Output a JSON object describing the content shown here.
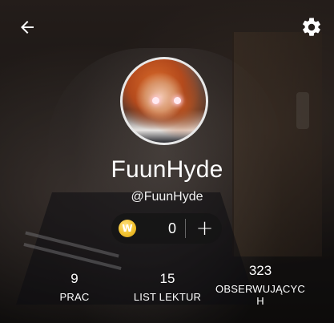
{
  "header": {
    "back_icon": "arrow-left-icon",
    "settings_icon": "gear-icon"
  },
  "profile": {
    "username": "FuunHyde",
    "handle": "@FuunHyde"
  },
  "coins": {
    "icon": "coin-w-icon",
    "icon_letter": "W",
    "count": "0",
    "add_label": "+",
    "coin_color": "#f4c534"
  },
  "stats": [
    {
      "value": "9",
      "label": "PRAC"
    },
    {
      "value": "15",
      "label": "LIST LEKTUR"
    },
    {
      "value": "323",
      "label": "OBSERWUJĄCYC\nH"
    }
  ]
}
